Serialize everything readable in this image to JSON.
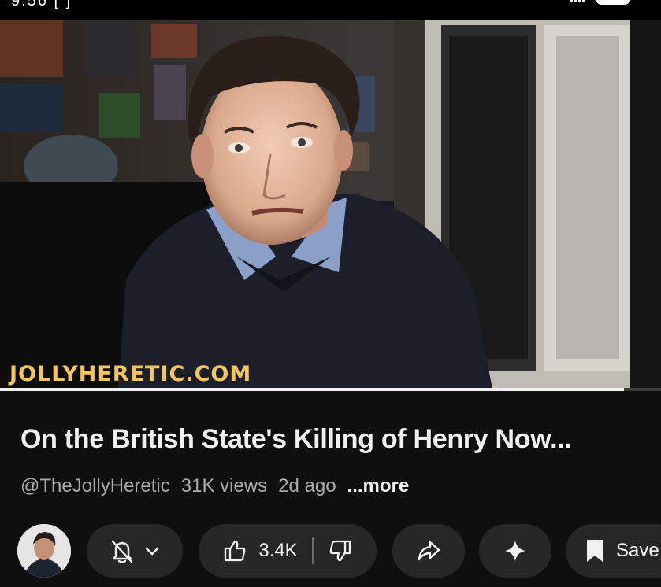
{
  "status_bar": {
    "left_text": "9:56 [ ]"
  },
  "video": {
    "watermark": "JOLLYHERETIC.COM",
    "progress_fraction": 0.944
  },
  "details": {
    "title": "On the British State's Killing of Henry Now...",
    "channel": "@TheJollyHeretic",
    "views": "31K views",
    "age": "2d ago",
    "more": "...more"
  },
  "actions": {
    "avatar_icon": "channel-avatar",
    "bell_icon": "bell-off-icon",
    "chevron_icon": "chevron-down-icon",
    "like_count": "3.4K",
    "like_icon": "thumb-up-icon",
    "dislike_icon": "thumb-down-icon",
    "share_icon": "share-icon",
    "ask_icon": "sparkle-icon",
    "save_label": "Save",
    "save_icon": "bookmark-icon"
  },
  "colors": {
    "background": "#0f0f0f",
    "pill": "#272727",
    "watermark": "#f3c55a",
    "secondary_text": "#aaaaaa"
  }
}
